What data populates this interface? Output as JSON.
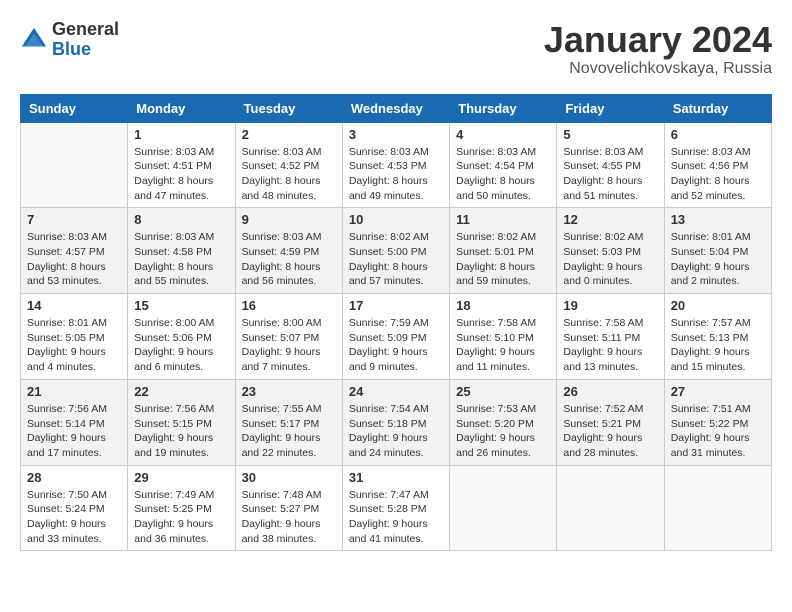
{
  "logo": {
    "general": "General",
    "blue": "Blue"
  },
  "title": {
    "month": "January 2024",
    "location": "Novovelichkovskaya, Russia"
  },
  "weekdays": [
    "Sunday",
    "Monday",
    "Tuesday",
    "Wednesday",
    "Thursday",
    "Friday",
    "Saturday"
  ],
  "weeks": [
    [
      {
        "day": "",
        "info": ""
      },
      {
        "day": "1",
        "info": "Sunrise: 8:03 AM\nSunset: 4:51 PM\nDaylight: 8 hours\nand 47 minutes."
      },
      {
        "day": "2",
        "info": "Sunrise: 8:03 AM\nSunset: 4:52 PM\nDaylight: 8 hours\nand 48 minutes."
      },
      {
        "day": "3",
        "info": "Sunrise: 8:03 AM\nSunset: 4:53 PM\nDaylight: 8 hours\nand 49 minutes."
      },
      {
        "day": "4",
        "info": "Sunrise: 8:03 AM\nSunset: 4:54 PM\nDaylight: 8 hours\nand 50 minutes."
      },
      {
        "day": "5",
        "info": "Sunrise: 8:03 AM\nSunset: 4:55 PM\nDaylight: 8 hours\nand 51 minutes."
      },
      {
        "day": "6",
        "info": "Sunrise: 8:03 AM\nSunset: 4:56 PM\nDaylight: 8 hours\nand 52 minutes."
      }
    ],
    [
      {
        "day": "7",
        "info": "Sunrise: 8:03 AM\nSunset: 4:57 PM\nDaylight: 8 hours\nand 53 minutes."
      },
      {
        "day": "8",
        "info": "Sunrise: 8:03 AM\nSunset: 4:58 PM\nDaylight: 8 hours\nand 55 minutes."
      },
      {
        "day": "9",
        "info": "Sunrise: 8:03 AM\nSunset: 4:59 PM\nDaylight: 8 hours\nand 56 minutes."
      },
      {
        "day": "10",
        "info": "Sunrise: 8:02 AM\nSunset: 5:00 PM\nDaylight: 8 hours\nand 57 minutes."
      },
      {
        "day": "11",
        "info": "Sunrise: 8:02 AM\nSunset: 5:01 PM\nDaylight: 8 hours\nand 59 minutes."
      },
      {
        "day": "12",
        "info": "Sunrise: 8:02 AM\nSunset: 5:03 PM\nDaylight: 9 hours\nand 0 minutes."
      },
      {
        "day": "13",
        "info": "Sunrise: 8:01 AM\nSunset: 5:04 PM\nDaylight: 9 hours\nand 2 minutes."
      }
    ],
    [
      {
        "day": "14",
        "info": "Sunrise: 8:01 AM\nSunset: 5:05 PM\nDaylight: 9 hours\nand 4 minutes."
      },
      {
        "day": "15",
        "info": "Sunrise: 8:00 AM\nSunset: 5:06 PM\nDaylight: 9 hours\nand 6 minutes."
      },
      {
        "day": "16",
        "info": "Sunrise: 8:00 AM\nSunset: 5:07 PM\nDaylight: 9 hours\nand 7 minutes."
      },
      {
        "day": "17",
        "info": "Sunrise: 7:59 AM\nSunset: 5:09 PM\nDaylight: 9 hours\nand 9 minutes."
      },
      {
        "day": "18",
        "info": "Sunrise: 7:58 AM\nSunset: 5:10 PM\nDaylight: 9 hours\nand 11 minutes."
      },
      {
        "day": "19",
        "info": "Sunrise: 7:58 AM\nSunset: 5:11 PM\nDaylight: 9 hours\nand 13 minutes."
      },
      {
        "day": "20",
        "info": "Sunrise: 7:57 AM\nSunset: 5:13 PM\nDaylight: 9 hours\nand 15 minutes."
      }
    ],
    [
      {
        "day": "21",
        "info": "Sunrise: 7:56 AM\nSunset: 5:14 PM\nDaylight: 9 hours\nand 17 minutes."
      },
      {
        "day": "22",
        "info": "Sunrise: 7:56 AM\nSunset: 5:15 PM\nDaylight: 9 hours\nand 19 minutes."
      },
      {
        "day": "23",
        "info": "Sunrise: 7:55 AM\nSunset: 5:17 PM\nDaylight: 9 hours\nand 22 minutes."
      },
      {
        "day": "24",
        "info": "Sunrise: 7:54 AM\nSunset: 5:18 PM\nDaylight: 9 hours\nand 24 minutes."
      },
      {
        "day": "25",
        "info": "Sunrise: 7:53 AM\nSunset: 5:20 PM\nDaylight: 9 hours\nand 26 minutes."
      },
      {
        "day": "26",
        "info": "Sunrise: 7:52 AM\nSunset: 5:21 PM\nDaylight: 9 hours\nand 28 minutes."
      },
      {
        "day": "27",
        "info": "Sunrise: 7:51 AM\nSunset: 5:22 PM\nDaylight: 9 hours\nand 31 minutes."
      }
    ],
    [
      {
        "day": "28",
        "info": "Sunrise: 7:50 AM\nSunset: 5:24 PM\nDaylight: 9 hours\nand 33 minutes."
      },
      {
        "day": "29",
        "info": "Sunrise: 7:49 AM\nSunset: 5:25 PM\nDaylight: 9 hours\nand 36 minutes."
      },
      {
        "day": "30",
        "info": "Sunrise: 7:48 AM\nSunset: 5:27 PM\nDaylight: 9 hours\nand 38 minutes."
      },
      {
        "day": "31",
        "info": "Sunrise: 7:47 AM\nSunset: 5:28 PM\nDaylight: 9 hours\nand 41 minutes."
      },
      {
        "day": "",
        "info": ""
      },
      {
        "day": "",
        "info": ""
      },
      {
        "day": "",
        "info": ""
      }
    ]
  ]
}
